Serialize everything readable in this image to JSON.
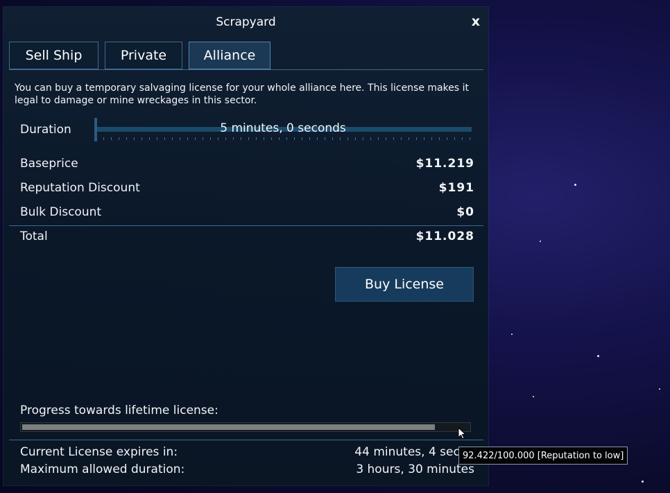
{
  "window": {
    "title": "Scrapyard",
    "close_label": "x"
  },
  "tabs": [
    {
      "label": "Sell Ship",
      "active": false
    },
    {
      "label": "Private",
      "active": false
    },
    {
      "label": "Alliance",
      "active": true
    }
  ],
  "description": "You can buy a temporary salvaging license for your whole alliance here. This license makes it legal to damage or mine wreckages in this sector.",
  "duration": {
    "label": "Duration",
    "value": "5 minutes, 0 seconds",
    "position": 0
  },
  "pricing": [
    {
      "label": "Baseprice",
      "value": "$11.219"
    },
    {
      "label": "Reputation Discount",
      "value": "$191"
    },
    {
      "label": "Bulk Discount",
      "value": "$0"
    }
  ],
  "total": {
    "label": "Total",
    "value": "$11.028"
  },
  "buy_button": {
    "label": "Buy License"
  },
  "lifetime": {
    "label": "Progress towards lifetime license:",
    "progress": 0.92422,
    "tooltip": "92.422/100.000 [Reputation to low]"
  },
  "status": [
    {
      "label": "Current License expires in:",
      "value": "44 minutes, 4 secon"
    },
    {
      "label": "Maximum allowed duration:",
      "value": "3 hours, 30 minutes"
    }
  ],
  "colors": {
    "accent_line": "#3e6b8f",
    "button_bg": "#173b5c",
    "progress_fill": "#7d8080"
  }
}
